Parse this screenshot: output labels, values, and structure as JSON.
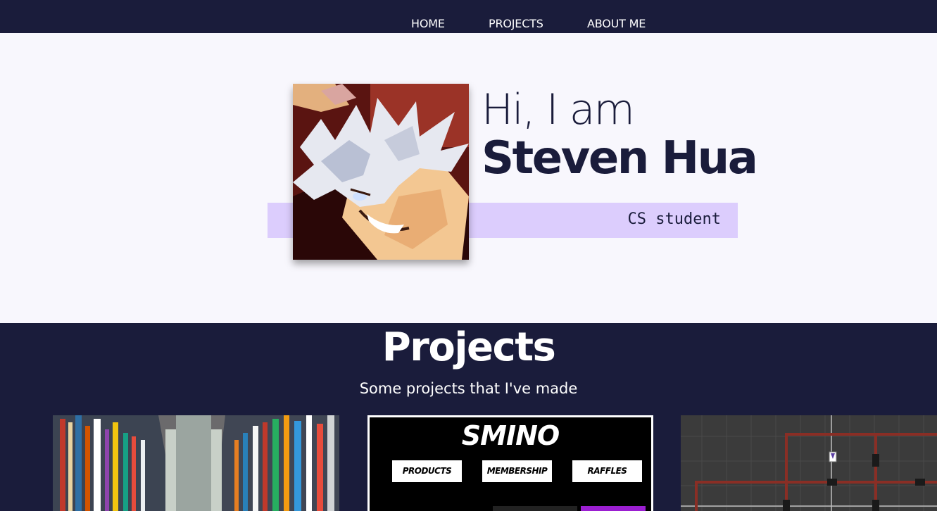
{
  "nav": {
    "items": [
      {
        "label": "HOME"
      },
      {
        "label": "PROJECTS"
      },
      {
        "label": "ABOUT ME"
      }
    ]
  },
  "hero": {
    "greeting": "Hi, I am",
    "name": "Steven Hua",
    "role": "CS student",
    "avatar_icon": "anime-portrait-avatar"
  },
  "projects": {
    "title": "Projects",
    "subtitle": "Some projects that I've made",
    "cards": [
      {
        "image": "library-bookshelves-thumbnail"
      },
      {
        "image": "smino-website-thumbnail",
        "brand": "SMINO",
        "buttons": [
          "PRODUCTS",
          "MEMBERSHIP",
          "RAFFLES"
        ]
      },
      {
        "image": "grid-path-game-thumbnail"
      }
    ]
  },
  "colors": {
    "navy": "#1a1c3b",
    "lavender": "#dccdfd",
    "background": "#f8f7fd"
  }
}
